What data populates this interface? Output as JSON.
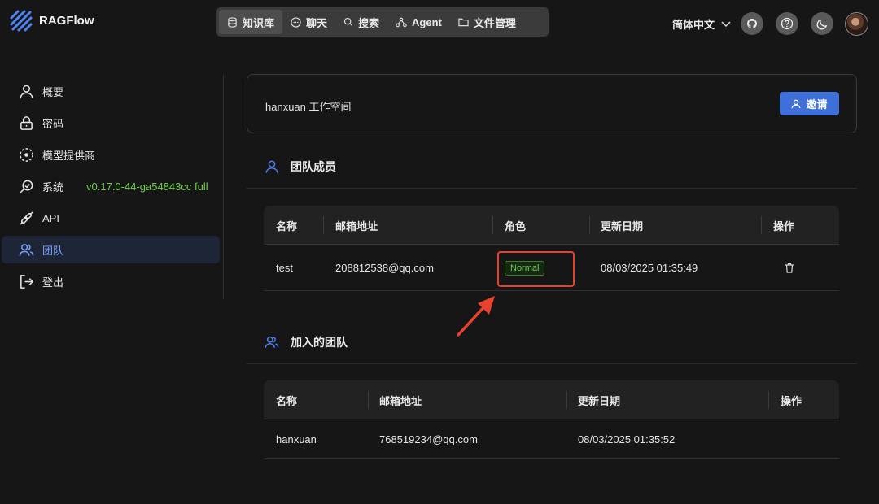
{
  "app": {
    "name": "RAGFlow"
  },
  "topnav": [
    {
      "label": "知识库",
      "icon": "database-icon"
    },
    {
      "label": "聊天",
      "icon": "chat-icon"
    },
    {
      "label": "搜索",
      "icon": "search-icon"
    },
    {
      "label": "Agent",
      "icon": "agent-icon"
    },
    {
      "label": "文件管理",
      "icon": "folder-icon"
    }
  ],
  "header": {
    "language": "简体中文"
  },
  "sidebar": {
    "items": [
      {
        "label": "概要",
        "icon": "user-icon"
      },
      {
        "label": "密码",
        "icon": "lock-icon"
      },
      {
        "label": "模型提供商",
        "icon": "model-icon"
      },
      {
        "label": "系统",
        "icon": "system-icon"
      },
      {
        "label": "API",
        "icon": "plug-icon"
      },
      {
        "label": "团队",
        "icon": "team-icon"
      },
      {
        "label": "登出",
        "icon": "logout-icon"
      }
    ],
    "version": "v0.17.0-44-ga54843cc full",
    "active": "团队"
  },
  "workspace": {
    "title": "hanxuan 工作空间",
    "invite_label": "邀请"
  },
  "members": {
    "title": "团队成员",
    "columns": [
      "名称",
      "邮箱地址",
      "角色",
      "更新日期",
      "操作"
    ],
    "rows": [
      {
        "name": "test",
        "email": "208812538@qq.com",
        "role": "Normal",
        "updated": "08/03/2025 01:35:49"
      }
    ]
  },
  "joined": {
    "title": "加入的团队",
    "columns": [
      "名称",
      "邮箱地址",
      "更新日期",
      "操作"
    ],
    "rows": [
      {
        "name": "hanxuan",
        "email": "768519234@qq.com",
        "updated": "08/03/2025 01:35:52"
      }
    ]
  },
  "colors": {
    "accent": "#3f6fd8",
    "version": "#6fd04a",
    "highlight": "#e8412c",
    "tag": "#78c95a"
  }
}
